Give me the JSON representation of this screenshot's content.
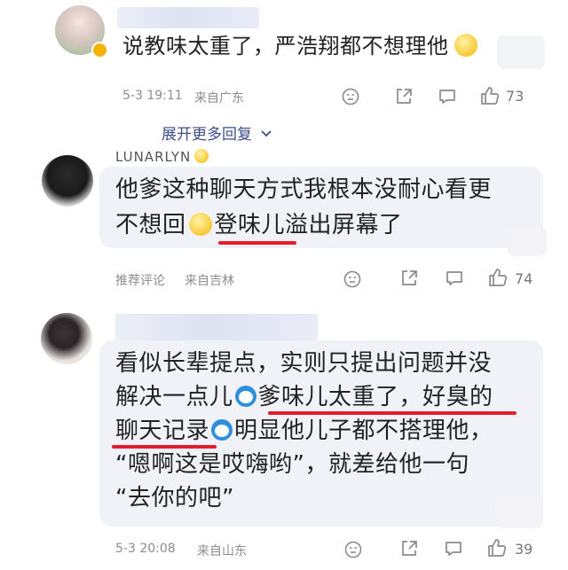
{
  "comments": [
    {
      "text_lines": [
        "说教味太重了，严浩翔都不想理他"
      ],
      "date": "5-3 19:11",
      "location": "来自广东",
      "likes": "73",
      "expand_label": "展开更多回复"
    },
    {
      "username": "LUNARLYN",
      "text_lines": [
        "他爹这种聊天方式我根本没耐心看更",
        "不想回",
        "登味儿溢出屏幕了"
      ],
      "tag": "推荐评论",
      "location": "来自吉林",
      "likes": "74"
    },
    {
      "text_lines": [
        "看似长辈提点，实则只提出问题并没",
        "解决一点儿",
        "爹味儿太重了，好臭的",
        "聊天记录",
        "明显他儿子都不搭理他，",
        "“嗯啊这是哎嗨哟”，就差给他一句",
        "“去你的吧”"
      ],
      "date": "5-3 20:08",
      "location": "来自山东",
      "likes": "39"
    }
  ],
  "icons": [
    "dislike-icon",
    "share-icon",
    "comment-icon",
    "like-icon",
    "chevron-down-icon",
    "verified-badge-icon"
  ],
  "colors": {
    "accent_underline": "#e21c2b",
    "link": "#3c4e8a",
    "bubble": "#f1f2f8"
  }
}
